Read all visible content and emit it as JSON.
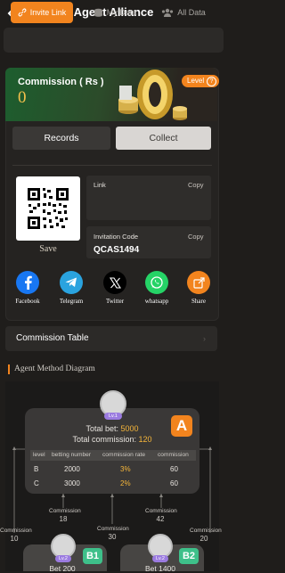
{
  "header": {
    "title": "Agent Alliance"
  },
  "tabs": [
    {
      "label": "Invite Link",
      "active": true
    },
    {
      "label": "My Data",
      "active": false
    },
    {
      "label": "All Data",
      "active": false
    }
  ],
  "commission": {
    "label": "Commission ( Rs )",
    "value": "0",
    "level_label": "Level",
    "records_label": "Records",
    "collect_label": "Collect"
  },
  "invite": {
    "save_label": "Save",
    "link_label": "Link",
    "link_copy": "Copy",
    "code_label": "Invitation Code",
    "code_copy": "Copy",
    "code_value": "QCAS1494"
  },
  "share": [
    {
      "label": "Facebook",
      "icon": "facebook-icon",
      "color": "#1877f2"
    },
    {
      "label": "Telegram",
      "icon": "telegram-icon",
      "color": "#2aa3df"
    },
    {
      "label": "Twitter",
      "icon": "x-icon",
      "color": "#000000"
    },
    {
      "label": "whatsapp",
      "icon": "whatsapp-icon",
      "color": "#25d366"
    },
    {
      "label": "Share",
      "icon": "share-icon",
      "color": "#f2841e"
    }
  ],
  "commission_table": {
    "label": "Commission Table"
  },
  "diagram": {
    "title": "Agent Method Diagram",
    "node_a": {
      "badge": "A",
      "level": "Lv.1",
      "total_bet_label": "Total bet:",
      "total_bet_value": "5000",
      "total_commission_label": "Total commission:",
      "total_commission_value": "120",
      "columns": [
        "level",
        "betting number",
        "commission rate",
        "commission"
      ],
      "rows": [
        {
          "level": "B",
          "betting": "2000",
          "rate": "3%",
          "commission": "60"
        },
        {
          "level": "C",
          "betting": "3000",
          "rate": "2%",
          "commission": "60"
        }
      ]
    },
    "commission_labels": {
      "label": "Commission",
      "left": "10",
      "mid_left": "18",
      "mid": "30",
      "mid_right": "42",
      "right": "20"
    },
    "node_b1": {
      "badge": "B1",
      "level": "Lv.2",
      "text": "Bet 200"
    },
    "node_b2": {
      "badge": "B2",
      "level": "Lv.2",
      "text": "Bet 1400"
    }
  },
  "colors": {
    "accent": "#f2841e",
    "gold": "#f5b53a",
    "green_badge": "#3ec08a"
  }
}
